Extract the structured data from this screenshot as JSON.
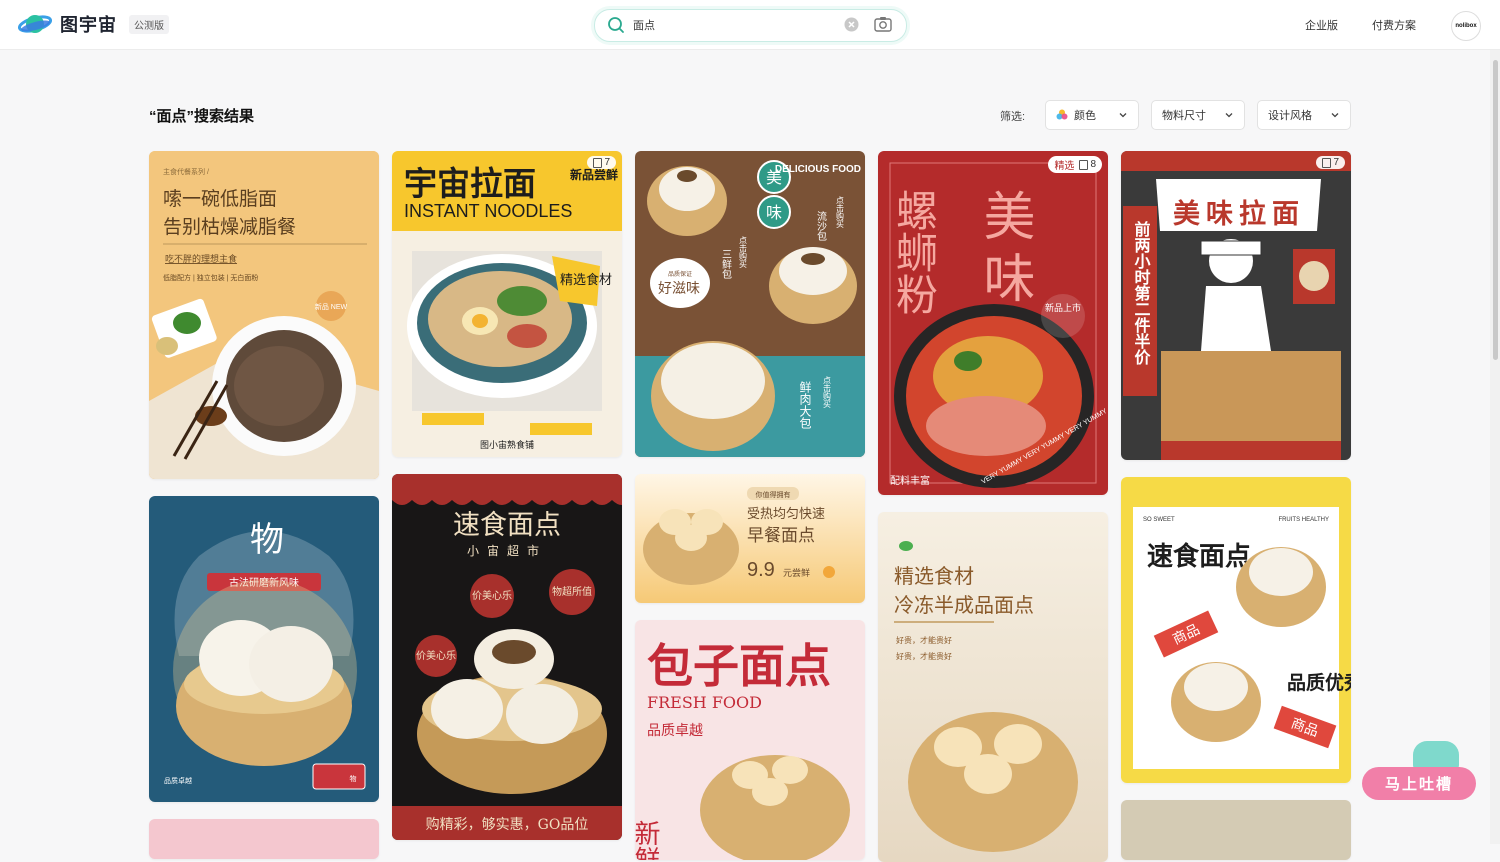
{
  "header": {
    "logo_text": "图宇宙",
    "beta_badge": "公测版",
    "nav": {
      "enterprise": "企业版",
      "pricing": "付费方案"
    },
    "avatar_text": "nolibox"
  },
  "search": {
    "value": "面点",
    "placeholder": ""
  },
  "results": {
    "title": "“面点”搜索结果"
  },
  "filters": {
    "label": "筛选:",
    "color": "颜色",
    "size": "物料尺寸",
    "style": "设计风格"
  },
  "cards": [
    {
      "badge": "",
      "series": "主食代餐系列 /",
      "line1": "嗦一碗低脂面",
      "line2": "告别枯燥减脂餐",
      "sub": "吃不胖的理想主食",
      "tags": "低脂配方 | 独立包装 | 无白面粉",
      "stamp": "新品 NEW"
    },
    {
      "badge": "7",
      "title": "宇宙拉面",
      "corner": "新品尝鲜",
      "en": "INSTANT NOODLES",
      "sticker": "精选食材",
      "footer": "图小宙熟食铺"
    },
    {
      "badge": "",
      "en": "DELICIOUS FOOD",
      "c1": "美",
      "c2": "味",
      "p1": "流沙包",
      "p2": "三鲜包",
      "p3": "鲜肉大包",
      "cta": "点击购买",
      "bubble": "好滋味",
      "bubble_small": "品质保证"
    },
    {
      "badge": "8",
      "tag": "精选",
      "t1": "螺蛳粉",
      "t2": "美味",
      "stamp": "新品上市",
      "footer": "配料丰富",
      "en": "VERY YUMMY VERY YUMMY VERY YUMMY"
    },
    {
      "badge": "7",
      "title": "美味拉面",
      "side": "前两小时第二件半价"
    },
    {
      "title": "古法研磨新风味",
      "big": "物",
      "footer": "品质卓越",
      "seal": "物"
    },
    {
      "title": "速食面点",
      "sub": "小宙超市",
      "b1": "价美心乐",
      "b2": "物超所值",
      "b3": "价美心乐",
      "footer": "购精彩，够实惠，GO品位"
    },
    {
      "tag": "你值得拥有",
      "t1": "受热均匀快速",
      "t2": "早餐面点",
      "price": "9.9",
      "unit": "元尝鲜"
    },
    {
      "title": "精选食材",
      "title2": "冷冻半成品面点",
      "s1": "好贵，才能贵好",
      "s2": "好贵，才能贵好"
    },
    {
      "so": "SO SWEET",
      "fr": "FRUITS HEALTHY",
      "title": "速食面点",
      "tag1": "商品",
      "q": "品质优秀",
      "tag2": "商品"
    },
    {
      "title": "包子面点",
      "en": "FRESH FOOD",
      "sub": "品质卓越",
      "side": "新鲜"
    }
  ],
  "feedback": {
    "label": "马上吐槽"
  }
}
